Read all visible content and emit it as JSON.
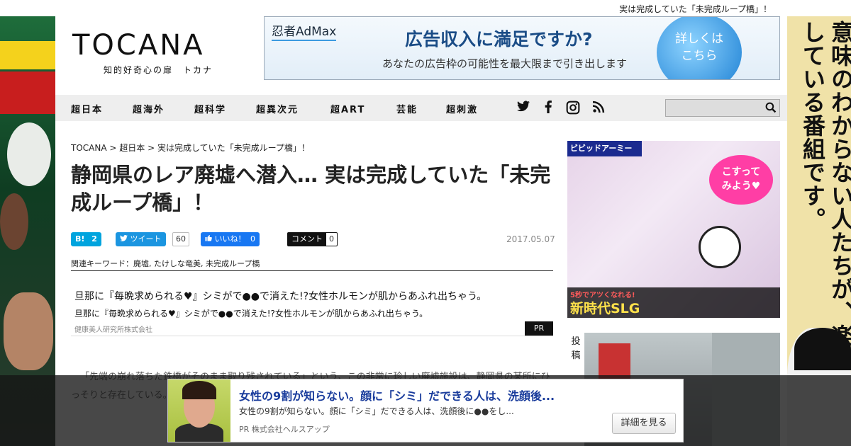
{
  "topline": {
    "text": "実は完成していた「未完成ループ橋」！"
  },
  "logo": {
    "wordmark": "TOCANA",
    "tagline": "知的好奇心の扉　トカナ"
  },
  "header_ad": {
    "brand": "忍者AdMax",
    "headline": "広告収入に満足ですか?",
    "subline": "あなたの広告枠の可能性を最大限まで引き出します",
    "cta": "詳しくは\nこちら"
  },
  "nav": {
    "items": [
      "超日本",
      "超海外",
      "超科学",
      "超異次元",
      "超ART",
      "芸能",
      "超刺激"
    ],
    "social_icons": [
      "twitter-icon",
      "facebook-icon",
      "instagram-icon",
      "rss-icon"
    ],
    "search_placeholder": ""
  },
  "breadcrumb": {
    "items": [
      "TOCANA",
      "超日本",
      "実は完成していた「未完成ループ橋」！"
    ],
    "separator": " > "
  },
  "article": {
    "title": "静岡県のレア廃墟へ潜入… 実は完成していた「未完成ループ橋」！",
    "date": "2017.05.07",
    "keywords_label": "関連キーワード：",
    "keywords": "廃墟, たけしな竜美, 未完成ループ橋",
    "body": "「先端の崩れ落ちた鉄橋がそのまま取り残されている」という、この非常に珍しい廃墟施設は、静岡県の某所にひっそりと存在している。皆さんは「未完成ループ橋」と呼ばれていますが、正式には…"
  },
  "share": {
    "hatena_label": "B!",
    "hatena_count": "2",
    "tweet_label": "ツイート",
    "tweet_count": "60",
    "like_label": "いいね！",
    "like_count": "0",
    "comment_label": "コメント",
    "comment_count": "0"
  },
  "pr_box": {
    "line1": "旦那に『毎晩求められる♥』シミがで●●で消えた!?女性ホルモンが肌からあふれ出ちゃう。",
    "line2": "旦那に『毎晩求められる♥』シミがで●●で消えた!?女性ホルモンが肌からあふれ出ちゃう。",
    "advertiser": "健康美人研究所株式会社",
    "tag": "PR"
  },
  "sidebar_ad": {
    "brand": "ビビッドアーミー",
    "bubble": "こすって\nみよう♥",
    "small": "5秒でアツくなれる!",
    "big": "新時代SLG"
  },
  "post": {
    "label": "投\n稿"
  },
  "side_right": {
    "text": "意味のわからない人たちが、楽しそうにしている番組です。"
  },
  "footer_ad": {
    "headline": "女性の9割が知らない。顔に「シミ」だできる人は、洗顔後...",
    "sub": "女性の9割が知らない。顔に「シミ」だできる人は、洗顔後に●●をし...",
    "advertiser": "PR 株式会社ヘルスアップ",
    "button": "詳細を見る"
  }
}
